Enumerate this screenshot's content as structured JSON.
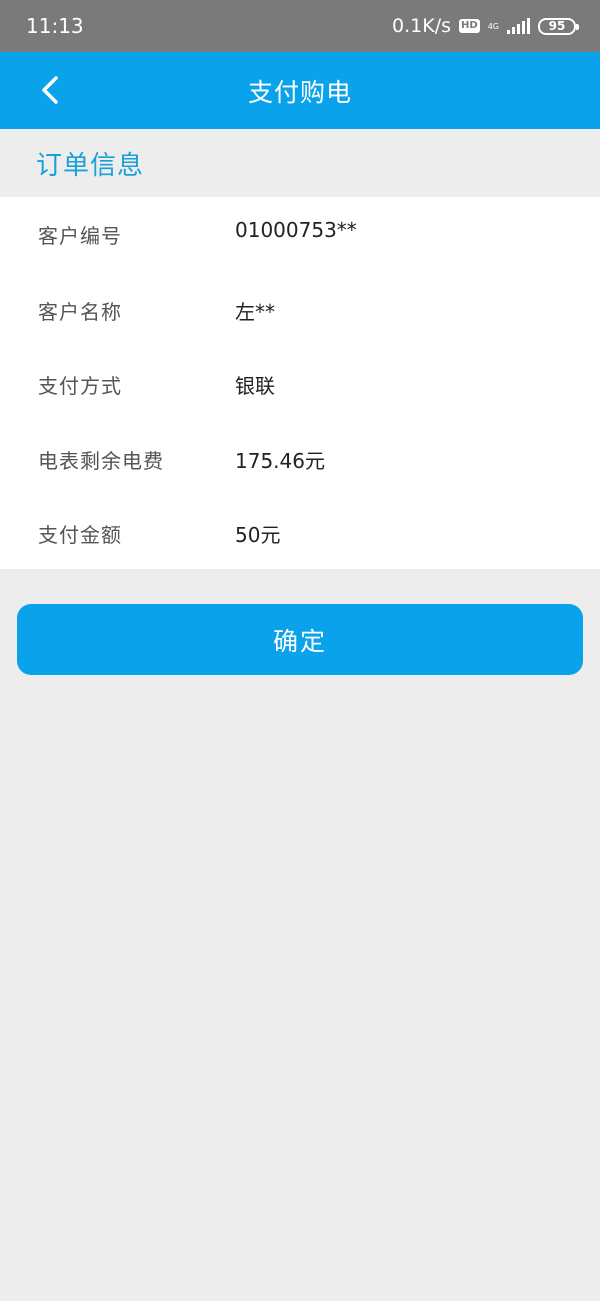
{
  "status_bar": {
    "time": "11:13",
    "network_speed": "0.1K/s",
    "hd_label": "HD",
    "network_type": "4G",
    "battery": "95"
  },
  "app_bar": {
    "title": "支付购电",
    "back_icon": "chevron-left-icon"
  },
  "order_info": {
    "section_title": "订单信息",
    "rows": [
      {
        "label": "客户编号",
        "value": "01000753**"
      },
      {
        "label": "客户名称",
        "value": "左**"
      },
      {
        "label": "支付方式",
        "value": "银联"
      },
      {
        "label": "电表剩余电费",
        "value": "175.46元"
      },
      {
        "label": "支付金额",
        "value": "50元"
      }
    ]
  },
  "actions": {
    "confirm_label": "确定"
  },
  "colors": {
    "accent": "#0aa3eb",
    "section_title": "#1aa0d8",
    "status_bar": "#7a7a7a",
    "background": "#ededed"
  }
}
